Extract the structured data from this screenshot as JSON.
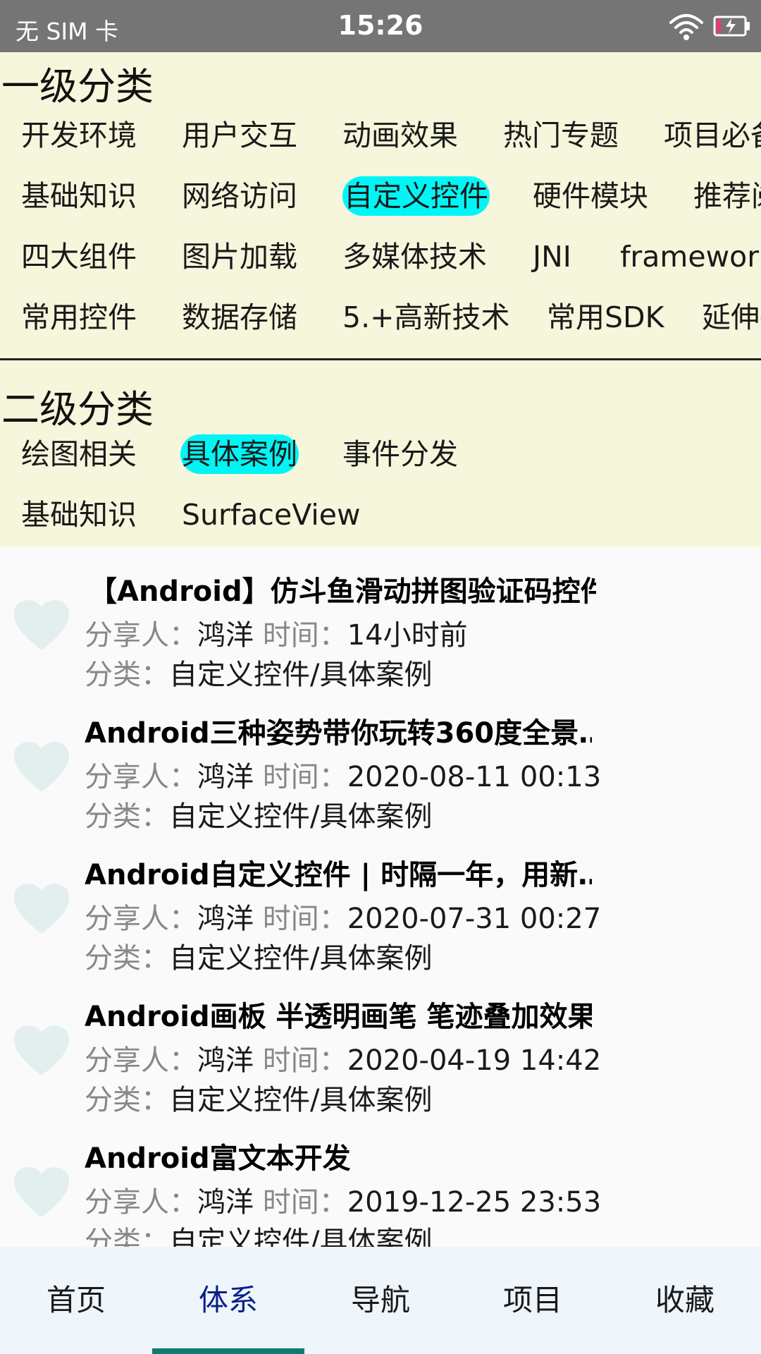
{
  "status_bar": {
    "carrier": "无 SIM 卡",
    "time": "15:26",
    "wifi_icon": "wifi-icon",
    "battery_icon": "battery-charging-icon"
  },
  "level1": {
    "title": "一级分类",
    "rows": [
      [
        "开发环境",
        "用户交互",
        "动画效果",
        "热门专题",
        "项目必备"
      ],
      [
        "基础知识",
        "网络访问",
        "自定义控件",
        "硬件模块",
        "推荐阅读"
      ],
      [
        "四大组件",
        "图片加载",
        "多媒体技术",
        "JNI",
        "framework"
      ],
      [
        "常用控件",
        "数据存储",
        "5.+高新技术",
        "常用SDK",
        "延伸技术"
      ]
    ],
    "selected": "自定义控件"
  },
  "level2": {
    "title": "二级分类",
    "rows": [
      [
        "绘图相关",
        "具体案例",
        "事件分发"
      ],
      [
        "基础知识",
        "SurfaceView"
      ]
    ],
    "selected": "具体案例"
  },
  "labels": {
    "sharer": "分享人：",
    "time": "时间：",
    "category": "分类："
  },
  "articles": [
    {
      "title": "【Android】仿斗鱼滑动拼图验证码控件",
      "author": "鸿洋",
      "time": "14小时前",
      "category": "自定义控件/具体案例"
    },
    {
      "title": "Android三种姿势带你玩转360度全景…",
      "author": "鸿洋",
      "time": "2020-08-11 00:13",
      "category": "自定义控件/具体案例"
    },
    {
      "title": "Android自定义控件 | 时隔一年，用新…",
      "author": "鸿洋",
      "time": "2020-07-31 00:27",
      "category": "自定义控件/具体案例"
    },
    {
      "title": "Android画板 半透明画笔 笔迹叠加效果",
      "author": "鸿洋",
      "time": "2020-04-19 14:42",
      "category": "自定义控件/具体案例"
    },
    {
      "title": "Android富文本开发",
      "author": "鸿洋",
      "time": "2019-12-25 23:53",
      "category": "自定义控件/具体案例"
    }
  ],
  "bottom_nav": {
    "items": [
      "首页",
      "体系",
      "导航",
      "项目",
      "收藏"
    ],
    "active": "体系"
  },
  "colors": {
    "panel_bg": "#f6f6dc",
    "selected_chip": "#00f5f5",
    "heart": "#e3efef",
    "nav_bg": "#eef5fb",
    "nav_active_text": "#0b1f8a",
    "nav_indicator": "#127a6e"
  }
}
